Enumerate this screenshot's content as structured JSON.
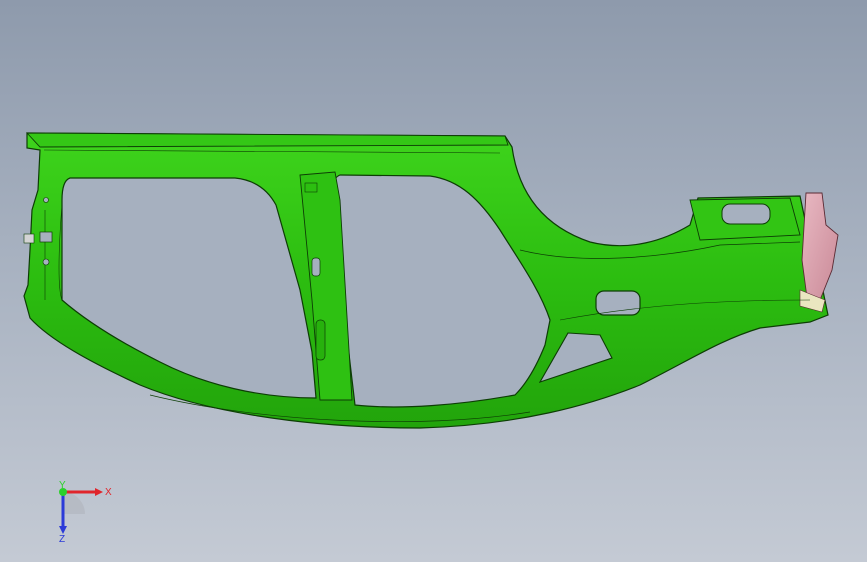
{
  "viewport": {
    "background_top": "#8e9aac",
    "background_bottom": "#c4cad4",
    "part_color": "#2fc412",
    "part_edge_color": "#0d3d05",
    "highlight_color": "#d9a5b0"
  },
  "triad": {
    "x_label": "X",
    "y_label": "Y",
    "z_label": "Z",
    "x_color": "#e0252b",
    "y_color": "#2bd12b",
    "z_color": "#2b3ad8"
  }
}
